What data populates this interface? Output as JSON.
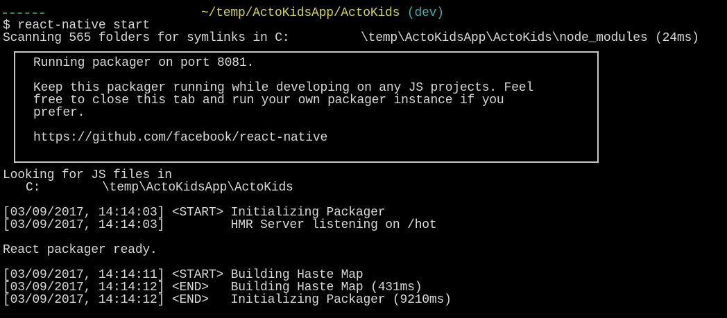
{
  "prompt": {
    "path": "~/temp/ActoKidsApp/ActoKids",
    "branch": "(dev)"
  },
  "command": "$ react-native start",
  "scanning": {
    "prefix": "Scanning 565 folders for symlinks in C:",
    "path": "\\temp\\ActoKidsApp\\ActoKids\\node_modules (24ms)"
  },
  "banner": {
    "line1": "Running packager on port 8081.",
    "line2": "Keep this packager running while developing on any JS projects. Feel",
    "line3": "free to close this tab and run your own packager instance if you",
    "line4": "prefer.",
    "url": "https://github.com/facebook/react-native"
  },
  "looking": {
    "label": "Looking for JS files in",
    "drive": "C:",
    "path": "\\temp\\ActoKidsApp\\ActoKids"
  },
  "logs1": [
    "[03/09/2017, 14:14:03] <START> Initializing Packager",
    "[03/09/2017, 14:14:03]         HMR Server listening on /hot"
  ],
  "ready": "React packager ready.",
  "logs2": [
    "[03/09/2017, 14:14:11] <START> Building Haste Map",
    "[03/09/2017, 14:14:12] <END>   Building Haste Map (431ms)",
    "[03/09/2017, 14:14:12] <END>   Initializing Packager (9210ms)"
  ]
}
